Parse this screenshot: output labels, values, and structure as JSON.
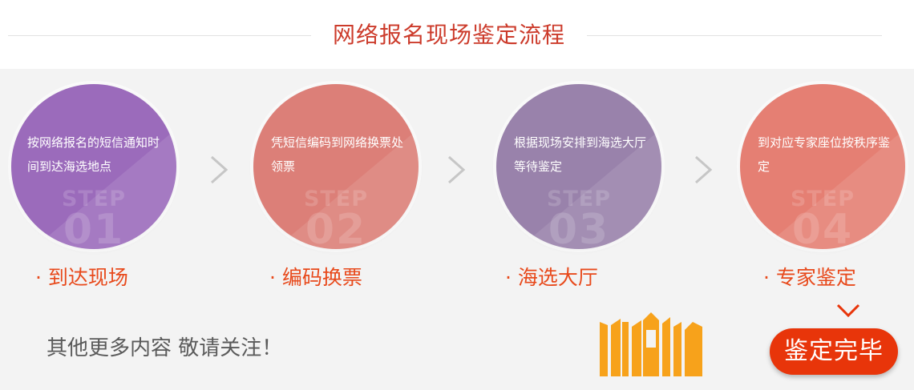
{
  "header": {
    "title": "网络报名现场鉴定流程"
  },
  "steps": [
    {
      "text": "按网络报名的短信通知时间到达海选地点",
      "mark_word": "STEP",
      "mark_num": "01",
      "label": "· 到达现场",
      "color": "#9b6bbb"
    },
    {
      "text": "凭短信编码到网络换票处领票",
      "mark_word": "STEP",
      "mark_num": "02",
      "label": "· 编码换票",
      "color": "#dc7f78"
    },
    {
      "text": "根据现场安排到海选大厅等待鉴定",
      "mark_word": "STEP",
      "mark_num": "03",
      "label": "· 海选大厅",
      "color": "#9982ab"
    },
    {
      "text": "到对应专家座位按秩序鉴定",
      "mark_word": "STEP",
      "mark_num": "04",
      "label": "· 专家鉴定",
      "color": "#e57f73"
    }
  ],
  "footer": {
    "note": "其他更多内容 敬请关注！",
    "done_label": "鉴定完毕"
  },
  "colors": {
    "accent_red": "#e8350a",
    "label_orange": "#e84a1c",
    "title_red": "#cc3b2b",
    "building_orange": "#f7a21b"
  }
}
